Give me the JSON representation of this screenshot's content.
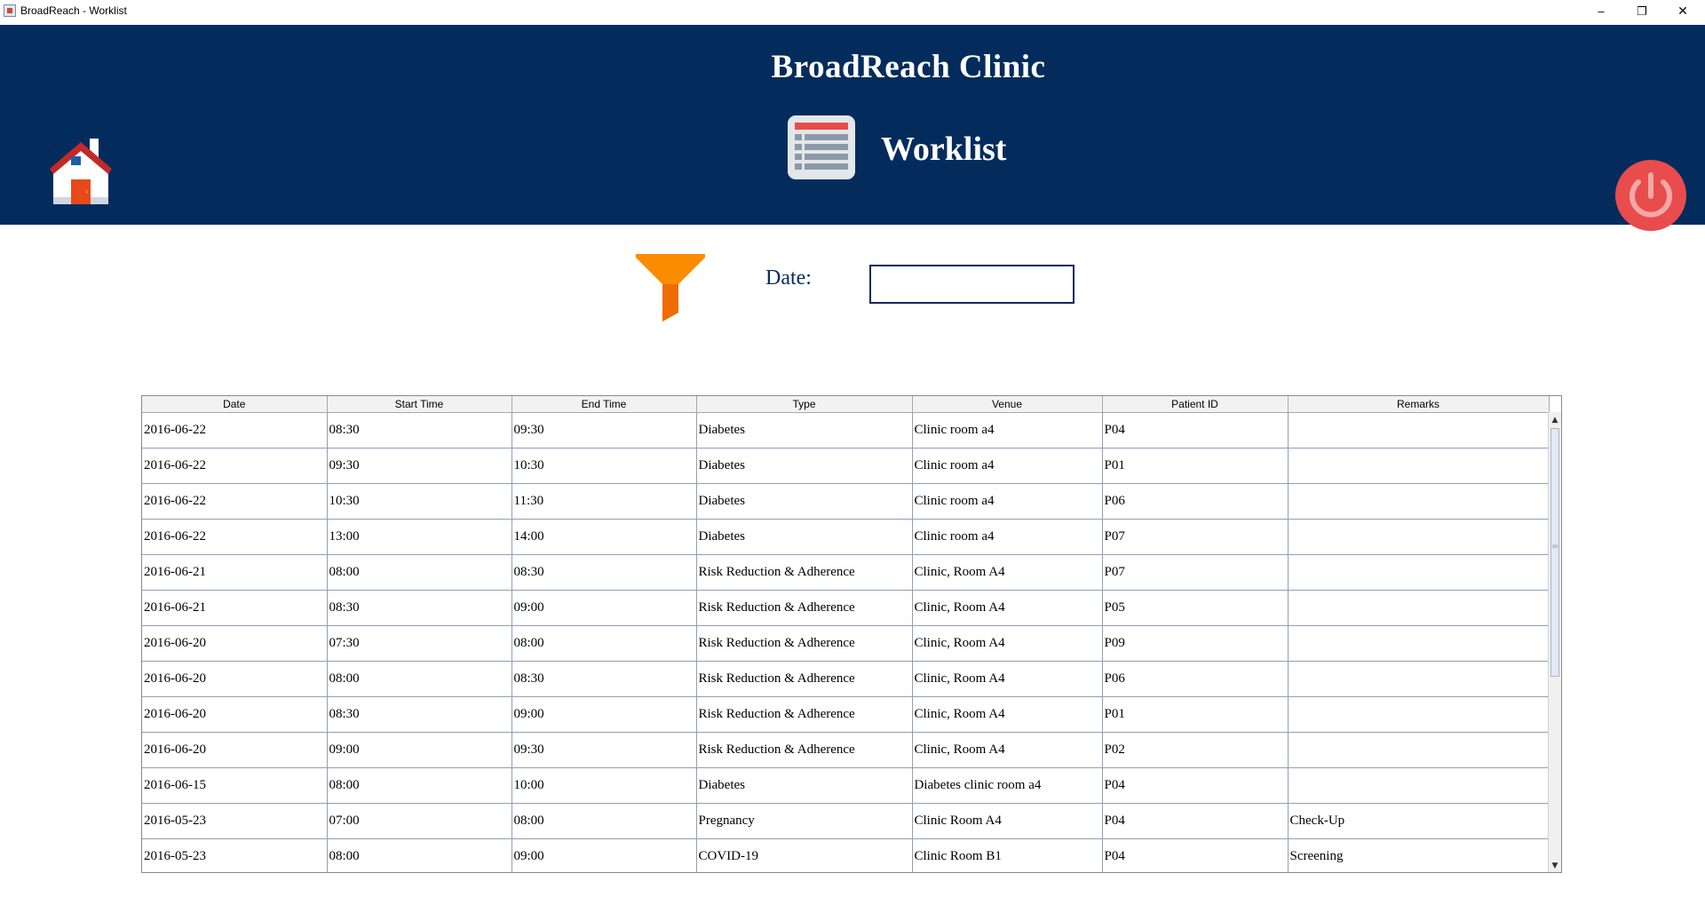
{
  "window": {
    "title": "BroadReach - Worklist",
    "minimize": "–",
    "restore": "❐",
    "close": "✕"
  },
  "header": {
    "clinic_name": "BroadReach Clinic",
    "page_title": "Worklist",
    "icons": [
      "home-icon",
      "worklist-icon",
      "power-icon"
    ],
    "colors": {
      "header_bg": "#032c5d",
      "power": "#e84c4c",
      "filter": "#fb8c00"
    }
  },
  "filter": {
    "date_label": "Date:",
    "date_value": ""
  },
  "table": {
    "columns": [
      "Date",
      "Start Time",
      "End Time",
      "Type",
      "Venue",
      "Patient ID",
      "Remarks"
    ],
    "rows": [
      [
        "2016-06-22",
        "08:30",
        "09:30",
        "Diabetes",
        "Clinic room a4",
        "P04",
        ""
      ],
      [
        "2016-06-22",
        "09:30",
        "10:30",
        "Diabetes",
        "Clinic room a4",
        "P01",
        ""
      ],
      [
        "2016-06-22",
        "10:30",
        "11:30",
        "Diabetes",
        "Clinic room a4",
        "P06",
        ""
      ],
      [
        "2016-06-22",
        "13:00",
        "14:00",
        "Diabetes",
        "Clinic room a4",
        "P07",
        ""
      ],
      [
        "2016-06-21",
        "08:00",
        "08:30",
        "Risk Reduction & Adherence",
        "Clinic, Room A4",
        "P07",
        ""
      ],
      [
        "2016-06-21",
        "08:30",
        "09:00",
        "Risk Reduction & Adherence",
        "Clinic, Room A4",
        "P05",
        ""
      ],
      [
        "2016-06-20",
        "07:30",
        "08:00",
        "Risk Reduction & Adherence",
        "Clinic, Room A4",
        "P09",
        ""
      ],
      [
        "2016-06-20",
        "08:00",
        "08:30",
        "Risk Reduction & Adherence",
        "Clinic, Room A4",
        "P06",
        ""
      ],
      [
        "2016-06-20",
        "08:30",
        "09:00",
        "Risk Reduction & Adherence",
        "Clinic, Room A4",
        "P01",
        ""
      ],
      [
        "2016-06-20",
        "09:00",
        "09:30",
        "Risk Reduction & Adherence",
        "Clinic, Room A4",
        "P02",
        ""
      ],
      [
        "2016-06-15",
        "08:00",
        "10:00",
        "Diabetes",
        "Diabetes clinic room a4",
        "P04",
        ""
      ],
      [
        "2016-05-23",
        "07:00",
        "08:00",
        "Pregnancy",
        "Clinic Room A4",
        "P04",
        "Check-Up"
      ],
      [
        "2016-05-23",
        "08:00",
        "09:00",
        "COVID-19",
        "Clinic Room B1",
        "P04",
        "Screening"
      ]
    ]
  }
}
